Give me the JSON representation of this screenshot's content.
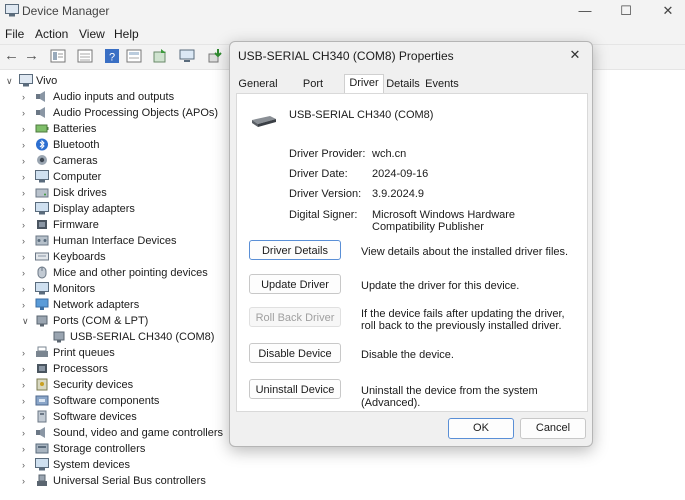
{
  "window": {
    "title": "Device Manager",
    "minimize": "—",
    "maximize": "☐",
    "close": "✕"
  },
  "menu": [
    "File",
    "Action",
    "View",
    "Help"
  ],
  "tree": {
    "root": "Vivo",
    "items": [
      {
        "label": "Audio inputs and outputs",
        "icon": "speaker-icon"
      },
      {
        "label": "Audio Processing Objects (APOs)",
        "icon": "speaker-icon"
      },
      {
        "label": "Batteries",
        "icon": "battery-icon"
      },
      {
        "label": "Bluetooth",
        "icon": "bluetooth-icon"
      },
      {
        "label": "Cameras",
        "icon": "camera-icon"
      },
      {
        "label": "Computer",
        "icon": "monitor-icon"
      },
      {
        "label": "Disk drives",
        "icon": "disk-icon"
      },
      {
        "label": "Display adapters",
        "icon": "monitor-icon"
      },
      {
        "label": "Firmware",
        "icon": "chip-icon"
      },
      {
        "label": "Human Interface Devices",
        "icon": "hid-icon"
      },
      {
        "label": "Keyboards",
        "icon": "keyboard-icon"
      },
      {
        "label": "Mice and other pointing devices",
        "icon": "mouse-icon"
      },
      {
        "label": "Monitors",
        "icon": "monitor-icon"
      },
      {
        "label": "Network adapters",
        "icon": "network-icon"
      },
      {
        "label": "Ports (COM & LPT)",
        "icon": "port-icon"
      },
      {
        "label": "USB-SERIAL CH340 (COM8)",
        "icon": "port-icon"
      },
      {
        "label": "Print queues",
        "icon": "printer-icon"
      },
      {
        "label": "Processors",
        "icon": "chip-icon"
      },
      {
        "label": "Security devices",
        "icon": "security-icon"
      },
      {
        "label": "Software components",
        "icon": "component-icon"
      },
      {
        "label": "Software devices",
        "icon": "device-icon"
      },
      {
        "label": "Sound, video and game controllers",
        "icon": "speaker-icon"
      },
      {
        "label": "Storage controllers",
        "icon": "storage-icon"
      },
      {
        "label": "System devices",
        "icon": "monitor-icon"
      },
      {
        "label": "Universal Serial Bus controllers",
        "icon": "usb-icon"
      }
    ]
  },
  "dialog": {
    "title": "USB-SERIAL CH340 (COM8) Properties",
    "close": "✕",
    "tabs": [
      "General",
      "Port Settings",
      "Driver",
      "Details",
      "Events"
    ],
    "active_tab": "Driver",
    "device_name": "USB-SERIAL CH340 (COM8)",
    "props": {
      "provider_label": "Driver Provider:",
      "provider": "wch.cn",
      "date_label": "Driver Date:",
      "date": "2024-09-16",
      "version_label": "Driver Version:",
      "version": "3.9.2024.9",
      "signer_label": "Digital Signer:",
      "signer": "Microsoft Windows Hardware Compatibility Publisher"
    },
    "actions": {
      "details_label": "Driver Details",
      "details_desc": "View details about the installed driver files.",
      "update_label": "Update Driver",
      "update_desc": "Update the driver for this device.",
      "rollback_label": "Roll Back Driver",
      "rollback_desc": "If the device fails after updating the driver, roll back to the previously installed driver.",
      "disable_label": "Disable Device",
      "disable_desc": "Disable the device.",
      "uninstall_label": "Uninstall Device",
      "uninstall_desc": "Uninstall the device from the system (Advanced)."
    },
    "ok_label": "OK",
    "cancel_label": "Cancel"
  }
}
